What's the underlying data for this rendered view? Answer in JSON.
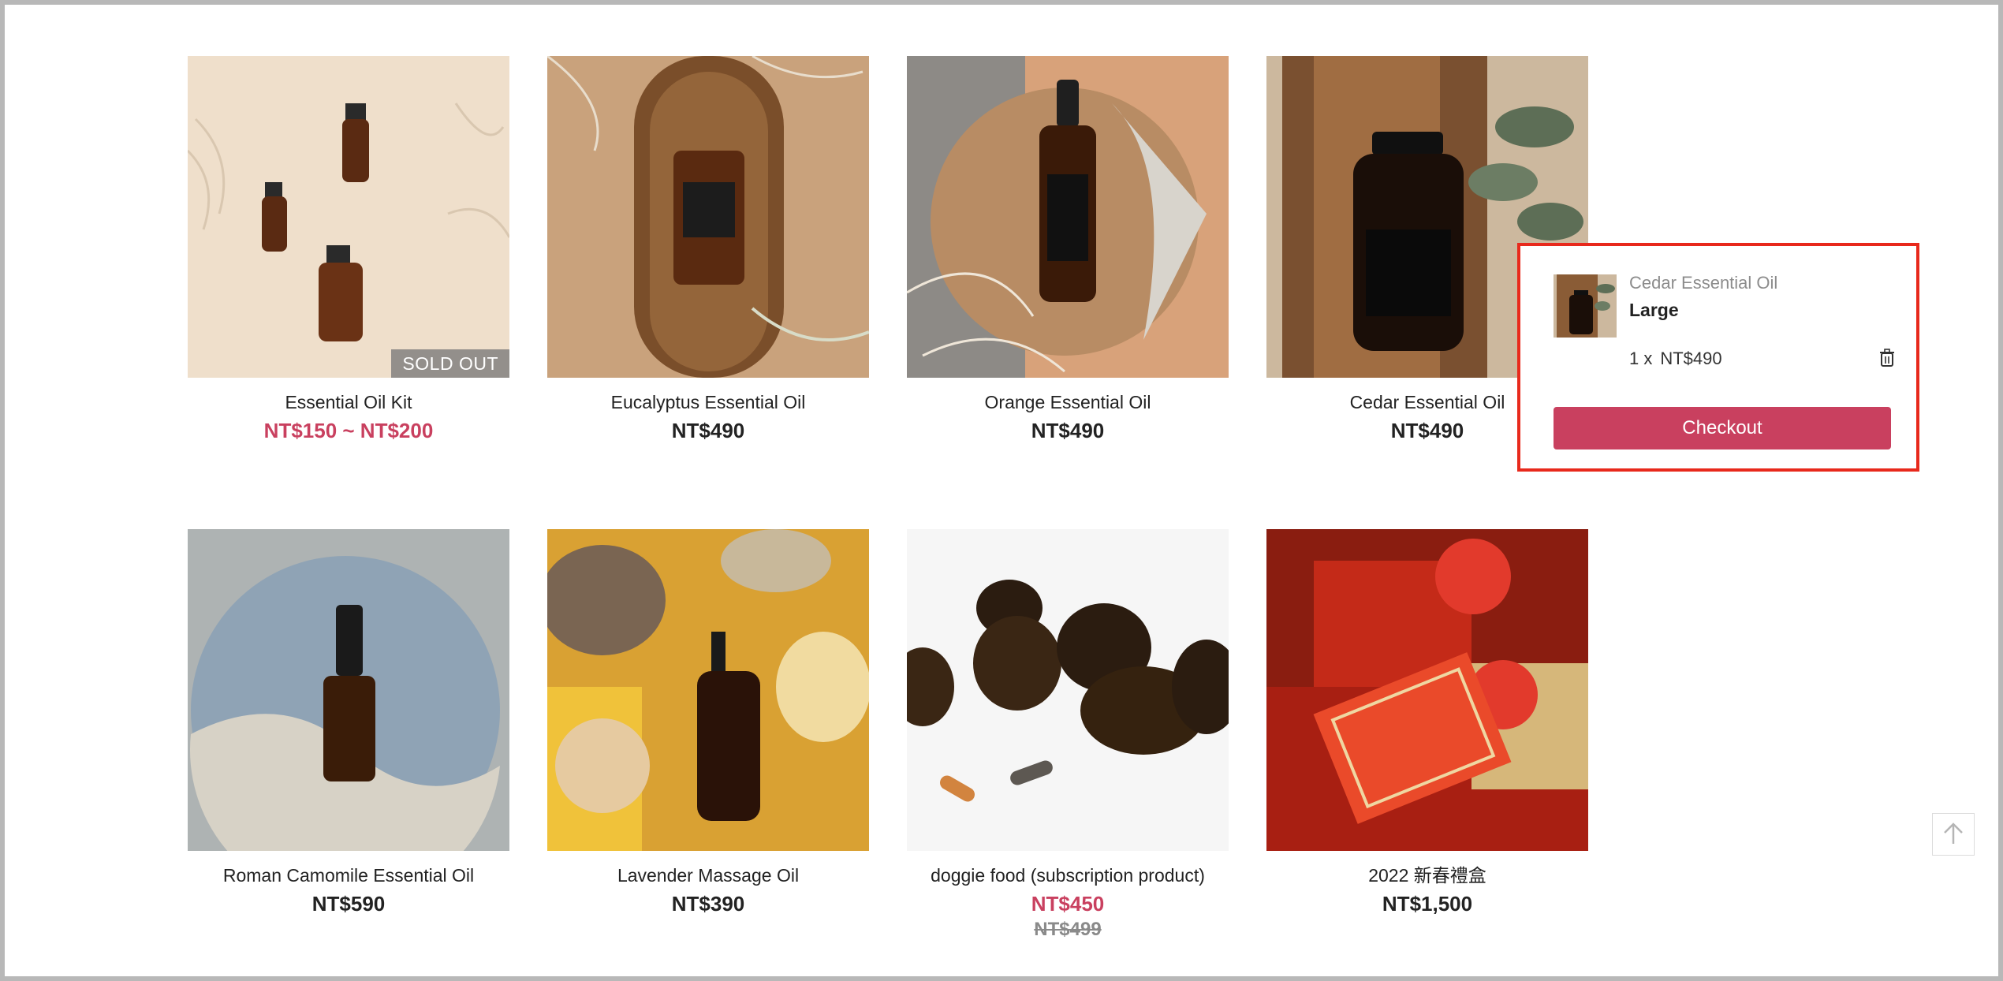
{
  "products": [
    {
      "name": "Essential Oil Kit",
      "price": "NT$150 ~ NT$200",
      "badge": "SOLD OUT"
    },
    {
      "name": "Eucalyptus Essential Oil",
      "price": "NT$490"
    },
    {
      "name": "Orange Essential Oil",
      "price": "NT$490"
    },
    {
      "name": "Cedar Essential Oil",
      "price": "NT$490"
    },
    {
      "name": "Roman Camomile Essential Oil",
      "price": "NT$590"
    },
    {
      "name": "Lavender Massage Oil",
      "price": "NT$390"
    },
    {
      "name": "doggie food (subscription product)",
      "price": "NT$450",
      "original_price": "NT$499"
    },
    {
      "name": "2022 新春禮盒",
      "price": "NT$1,500"
    }
  ],
  "cart": {
    "item_name": "Cedar Essential Oil",
    "variant": "Large",
    "quantity_label": "1 x",
    "item_price": "NT$490",
    "checkout_label": "Checkout",
    "trash_icon": "trash-icon"
  },
  "back_to_top_icon": "arrow-up-icon",
  "colors": {
    "accent": "#c9405f",
    "highlight_border": "#e8291c",
    "sold_out_badge": "#787878"
  }
}
